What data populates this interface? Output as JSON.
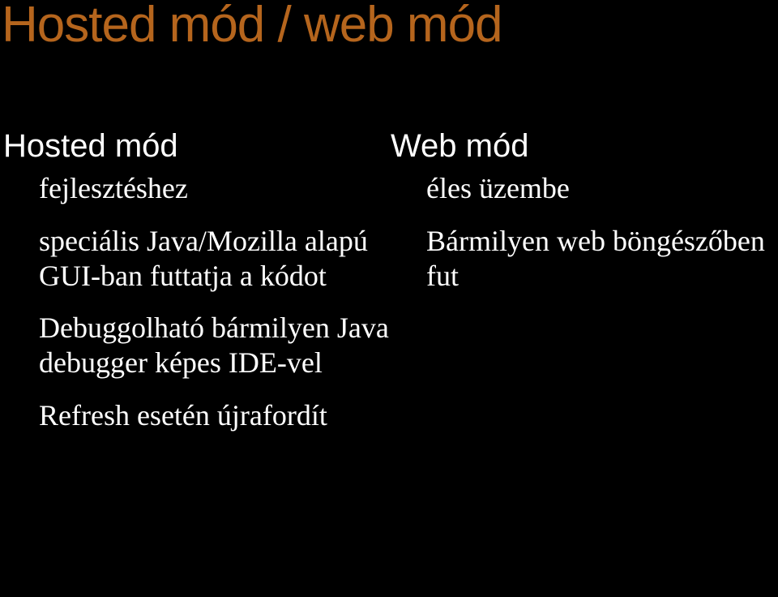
{
  "slide": {
    "title": "Hosted mód / web mód",
    "left": {
      "heading": "Hosted mód",
      "items": [
        "fejlesztéshez",
        "speciális Java/Mozilla alapú GUI-ban futtatja a kódot",
        "Debuggolható bármilyen Java debugger képes IDE-vel",
        "Refresh esetén újrafordít"
      ]
    },
    "right": {
      "heading": "Web mód",
      "items": [
        "éles üzembe",
        "Bármilyen web böngészőben fut"
      ]
    }
  }
}
